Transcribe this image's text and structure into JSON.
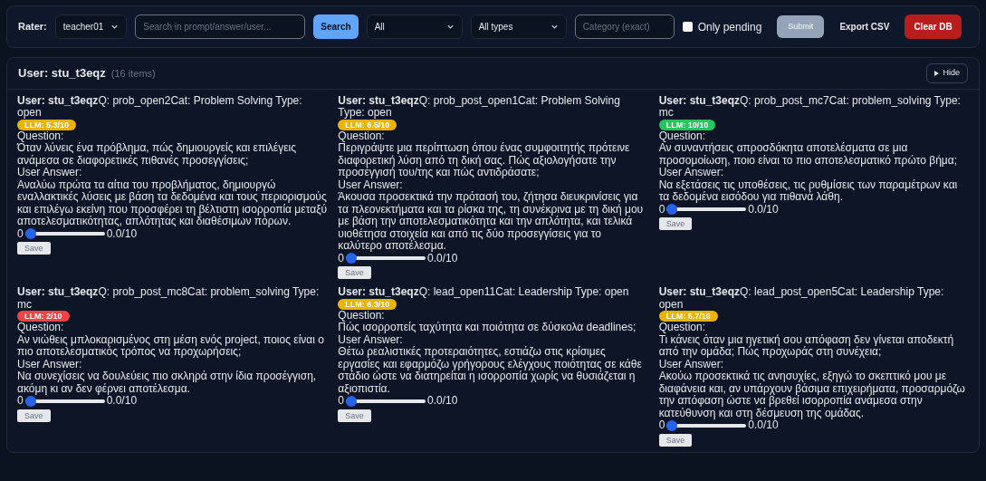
{
  "toolbar": {
    "rater_label": "Rater:",
    "rater": "teacher01",
    "search": {
      "placeholder": "Search in prompt/answer/user..."
    },
    "search_button": "Search",
    "status_filter": "All",
    "type_filter": "All types",
    "category": {
      "placeholder": "Category (exact)"
    },
    "only_pending": {
      "label": "Only pending",
      "checked": false
    },
    "submit": {
      "label": "Submit",
      "disabled": true
    },
    "export": "Export CSV",
    "clear": "Clear DB"
  },
  "group": {
    "title": "User: stu_t3eqz",
    "count": "(16 items)",
    "toggle": "Hide",
    "items": [
      {
        "header": "**User: stu_t3eqz**Q: prob_open2Cat: Problem Solving   Type: open",
        "badge": "LLM: 5.3/10",
        "color": "#eab308",
        "question_label": "Question:",
        "question": "Όταν λύνεις ένα πρόβλημα, πώς δημιουργείς και επιλέγεις ανάμεσα σε διαφορετικές πιθανές προσεγγίσεις;",
        "answer_label": "User Answer:",
        "answer": "Αναλύω πρώτα τα αίτια του προβλήματος, δημιουργώ εναλλακτικές λύσεις με βάση τα δεδομένα και τους περιορισμούς και επιλέγω εκείνη που προσφέρει τη βέλτιστη ισορροπία μεταξύ αποτελεσματικότητας, απλότητας και διαθέσιμων πόρων.",
        "min": "0",
        "level": 0,
        "reading": "0.0/10",
        "save": "Save"
      },
      {
        "header": "**User: stu_t3eqz**Q: prob_post_open1Cat: Problem Solving   Type: open",
        "badge": "LLM: 6.5/10",
        "color": "#eab308",
        "question_label": "Question:",
        "question": "Περιγράψτε μια περίπτωση όπου ένας συμφοιτητής πρότεινε διαφορετική λύση από τη δική σας. Πώς αξιολογήσατε την προσέγγισή του/της και πώς αντιδράσατε;",
        "answer_label": "User Answer:",
        "answer": "Άκουσα προσεκτικά την πρότασή του, ζήτησα διευκρινίσεις για τα πλεονεκτήματα και τα ρίσκα της, τη συνέκρινα με τη δική μου με βάση την αποτελεσματικότητα και την απλότητα, και τελικά υιοθέτησα στοιχεία και από τις δύο προσεγγίσεις για το καλύτερο αποτέλεσμα.",
        "min": "0",
        "level": 0,
        "reading": "0.0/10",
        "save": "Save"
      },
      {
        "header": "**User: stu_t3eqz**Q: prob_post_mc7Cat: problem_solving   Type: mc",
        "badge": "LLM: 10/10",
        "color": "#22c55e",
        "question_label": "Question:",
        "question": "Αν συναντήσεις απροσδόκητα αποτελέσματα σε μια προσομοίωση, ποιο είναι το πιο αποτελεσματικό πρώτο βήμα;",
        "answer_label": "User Answer:",
        "answer": "Να εξετάσεις τις υποθέσεις, τις ρυθμίσεις των παραμέτρων και τα δεδομένα εισόδου για πιθανά λάθη.",
        "min": "0",
        "level": 0,
        "reading": "0.0/10",
        "save": "Save"
      },
      {
        "header": "**User: stu_t3eqz**Q: prob_post_mc8Cat: problem_solving   Type: mc",
        "badge": "LLM: 2/10",
        "color": "#ef4444",
        "question_label": "Question:",
        "question": "Αν νιώθεις μπλοκαρισμένος στη μέση ενός project, ποιος είναι ο πιο αποτελεσματικός τρόπος να προχωρήσεις;",
        "answer_label": "User Answer:",
        "answer": "Να συνεχίσεις να δουλεύεις πιο σκληρά στην ίδια προσέγγιση, ακόμη κι αν δεν φέρνει αποτέλεσμα.",
        "min": "0",
        "level": 0,
        "reading": "0.0/10",
        "save": "Save"
      },
      {
        "header": "**User: stu_t3eqz**Q: lead_open11Cat: Leadership   Type: open",
        "badge": "LLM: 6.3/10",
        "color": "#eab308",
        "question_label": "Question:",
        "question": "Πώς ισορροπείς ταχύτητα και ποιότητα σε δύσκολα deadlines;",
        "answer_label": "User Answer:",
        "answer": "Θέτω ρεαλιστικές προτεραιότητες, εστιάζω στις κρίσιμες εργασίες και εφαρμόζω γρήγορους ελέγχους ποιότητας σε κάθε στάδιο ώστε να διατηρείται η ισορροπία χωρίς να θυσιάζεται η αξιοπιστία.",
        "min": "0",
        "level": 0,
        "reading": "0.0/10",
        "save": "Save"
      },
      {
        "header": "**User: stu_t3eqz**Q: lead_post_open5Cat: Leadership   Type: open",
        "badge": "LLM: 5.7/10",
        "color": "#eab308",
        "question_label": "Question:",
        "question": "Τι κάνεις όταν μια ηγετική σου απόφαση δεν γίνεται αποδεκτή από την ομάδα; Πώς προχωράς στη συνέχεια;",
        "answer_label": "User Answer:",
        "answer": "Ακούω προσεκτικά τις ανησυχίες, εξηγώ το σκεπτικό μου με διαφάνεια και, αν υπάρχουν βάσιμα επιχειρήματα, προσαρμόζω την απόφαση ώστε να βρεθεί ισορροπία ανάμεσα στην κατεύθυνση και στη δέσμευση της ομάδας.",
        "min": "0",
        "level": 0,
        "reading": "0.0/10",
        "save": "Save"
      }
    ]
  }
}
